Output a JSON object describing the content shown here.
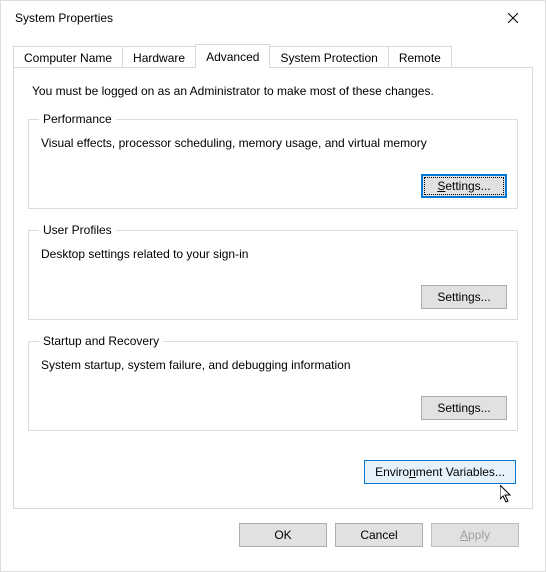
{
  "window": {
    "title": "System Properties"
  },
  "tabs": {
    "computer_name": "Computer Name",
    "hardware": "Hardware",
    "advanced": "Advanced",
    "system_protection": "System Protection",
    "remote": "Remote"
  },
  "intro": "You must be logged on as an Administrator to make most of these changes.",
  "groups": {
    "performance": {
      "legend": "Performance",
      "desc": "Visual effects, processor scheduling, memory usage, and virtual memory",
      "button": "Settings..."
    },
    "user_profiles": {
      "legend": "User Profiles",
      "desc": "Desktop settings related to your sign-in",
      "button": "Settings..."
    },
    "startup": {
      "legend": "Startup and Recovery",
      "desc": "System startup, system failure, and debugging information",
      "button": "Settings..."
    }
  },
  "env_button_prefix": "Enviro",
  "env_button_u": "n",
  "env_button_suffix": "ment Variables...",
  "buttons": {
    "ok": "OK",
    "cancel": "Cancel",
    "apply_u": "A",
    "apply_suffix": "pply"
  }
}
